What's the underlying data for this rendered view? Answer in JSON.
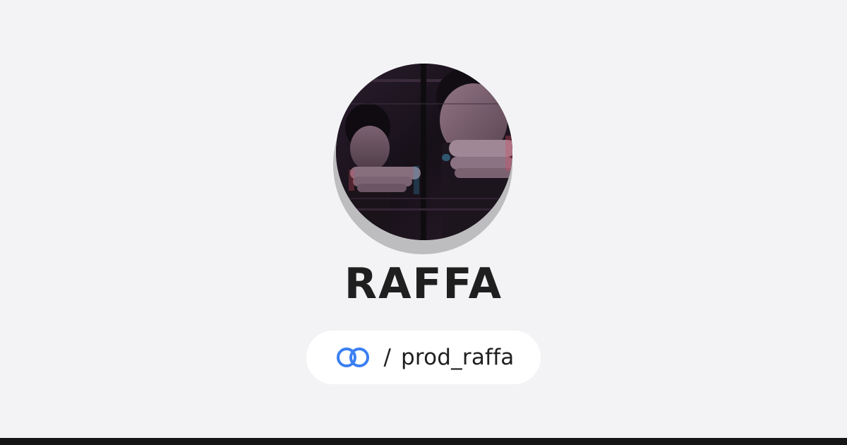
{
  "profile": {
    "name": "RAFFA",
    "avatar_alt": "Profile photo"
  },
  "handle": {
    "separator": "/",
    "username": "prod_raffa",
    "icon": "link-icon"
  },
  "colors": {
    "background": "#f3f3f5",
    "text": "#1f1f1f",
    "accent": "#3b7ff2",
    "pill": "#ffffff",
    "bottom_bar": "#151515"
  }
}
